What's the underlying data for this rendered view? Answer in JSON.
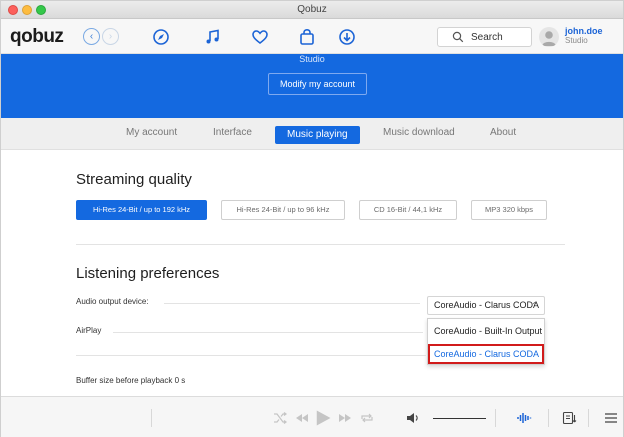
{
  "window": {
    "title": "Qobuz"
  },
  "toolbar": {
    "logo": "qobuz",
    "back_icon": "chevron-left-icon",
    "forward_icon": "chevron-right-icon",
    "icons": [
      "compass-icon",
      "music-note-icon",
      "heart-icon",
      "shopping-bag-icon",
      "download-icon"
    ],
    "search_placeholder": "Search",
    "user": {
      "name": "john.doe",
      "plan": "Studio"
    }
  },
  "banner": {
    "subtitle": "Studio",
    "modify_button": "Modify my account",
    "color": "#1469e0"
  },
  "tabs": {
    "items": [
      "My account",
      "Interface",
      "Music playing",
      "Music download",
      "About"
    ],
    "active": "Music playing"
  },
  "streaming": {
    "title": "Streaming quality",
    "options": [
      "Hi-Res 24-Bit / up to 192 kHz",
      "Hi-Res 24-Bit / up to 96 kHz",
      "CD 16-Bit / 44,1 kHz",
      "MP3 320 kbps"
    ],
    "selected": "Hi-Res 24-Bit / up to 192 kHz"
  },
  "listening": {
    "title": "Listening preferences",
    "audio_output_label": "Audio output device:",
    "audio_output_value": "CoreAudio - Clarus CODA",
    "airplay_label": "AirPlay",
    "buffer_label": "Buffer size before playback 0 s",
    "menu_options": [
      "CoreAudio - Built-In Output",
      "CoreAudio - Clarus CODA"
    ],
    "highlighted_option": "CoreAudio - Clarus CODA"
  },
  "player": {
    "icons": [
      "shuffle-icon",
      "previous-icon",
      "play-icon",
      "next-icon",
      "repeat-icon",
      "volume-icon",
      "equalizer-icon",
      "queue-icon",
      "list-icon"
    ]
  },
  "colors": {
    "accent": "#1469e0",
    "highlight_border": "#d11b1b"
  }
}
